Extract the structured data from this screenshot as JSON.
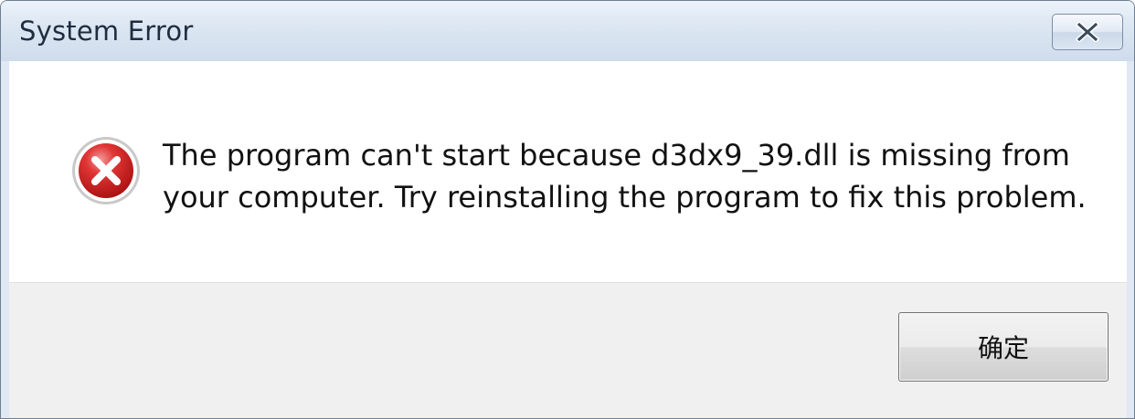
{
  "dialog": {
    "title": "System Error",
    "message": "The program can't start because d3dx9_39.dll is missing from your computer. Try reinstalling the program to fix this problem.",
    "icon": "error-icon",
    "ok_label": "确定",
    "close_icon": "close-icon"
  }
}
